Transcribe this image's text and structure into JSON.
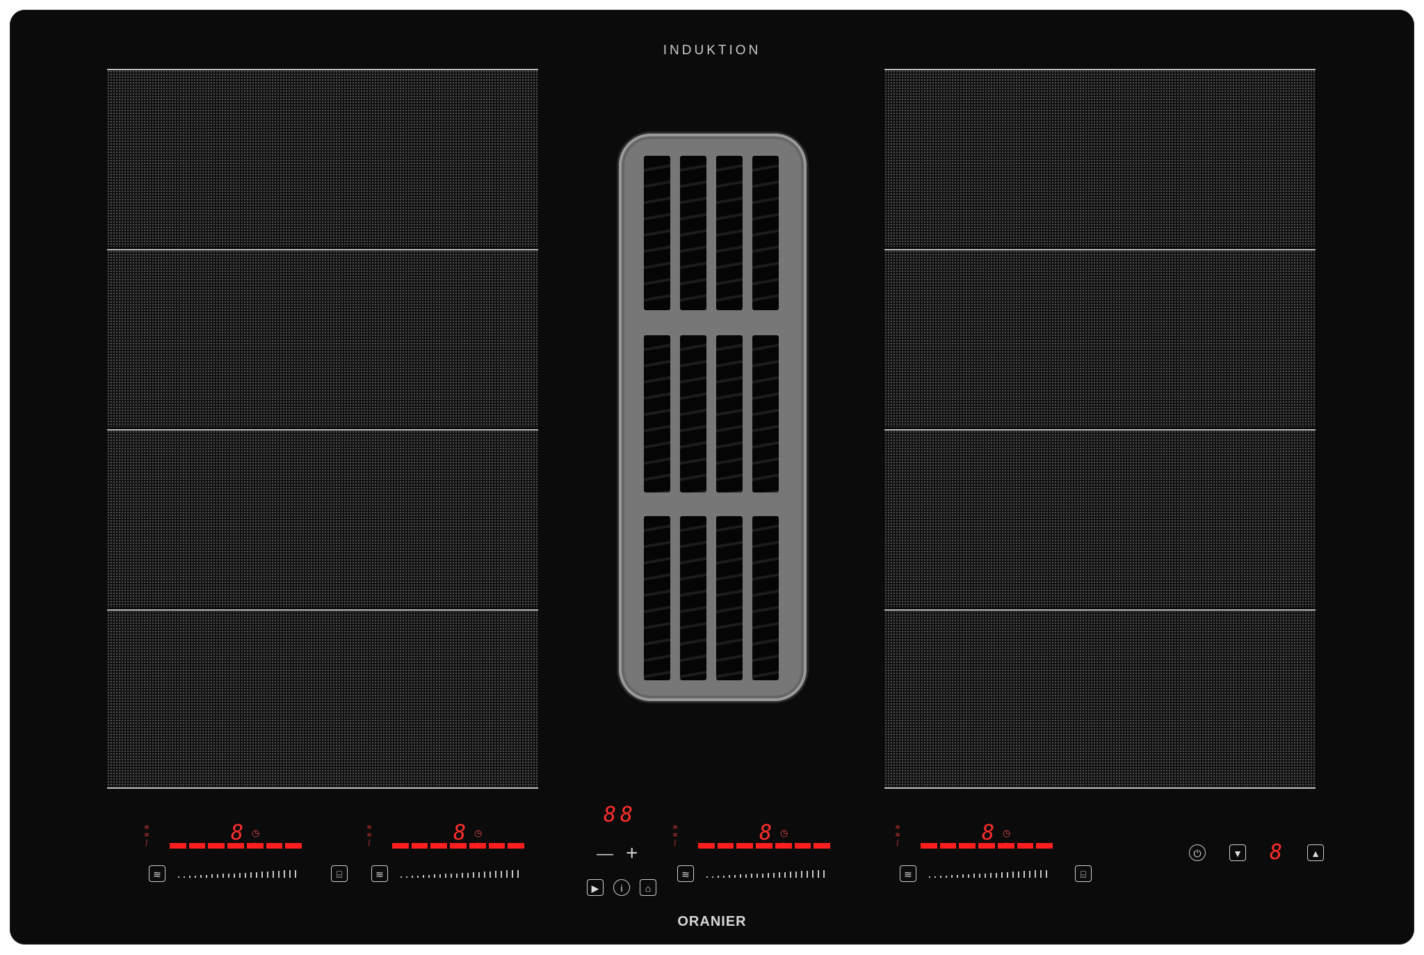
{
  "brand": {
    "top_label": "INDUKTION",
    "bottom_label": "ORANIER"
  },
  "cooking_zones": {
    "left": {
      "segments": 4
    },
    "right": {
      "segments": 4
    }
  },
  "hood_vent": {
    "rows": 3,
    "slots_per_row": 4
  },
  "controls": {
    "burners": [
      {
        "digit": "8",
        "timer_icon": "timer-icon",
        "heat_icon": "heat-levels-icon",
        "bridge_icon": "bridge-icon"
      },
      {
        "digit": "8",
        "timer_icon": "timer-icon",
        "heat_icon": "heat-levels-icon",
        "bridge_icon": "bridge-icon"
      },
      {
        "digit": "8",
        "timer_icon": "timer-icon",
        "heat_icon": "heat-levels-icon",
        "bridge_icon": "bridge-icon"
      },
      {
        "digit": "8",
        "timer_icon": "timer-icon",
        "heat_icon": "heat-levels-icon",
        "bridge_icon": "bridge-icon"
      }
    ],
    "center": {
      "display": "88",
      "minus": "—",
      "plus": "+",
      "play_icon": "play-icon",
      "info_icon": "info-icon",
      "lock_icon": "lock-icon"
    },
    "hood": {
      "power_icon": "power-icon",
      "down_icon": "arrow-down-icon",
      "level": "8",
      "up_icon": "arrow-up-icon"
    }
  },
  "colors": {
    "glass": "#0b0b0b",
    "display_red": "#ff2e2e",
    "grille": "#777777"
  }
}
